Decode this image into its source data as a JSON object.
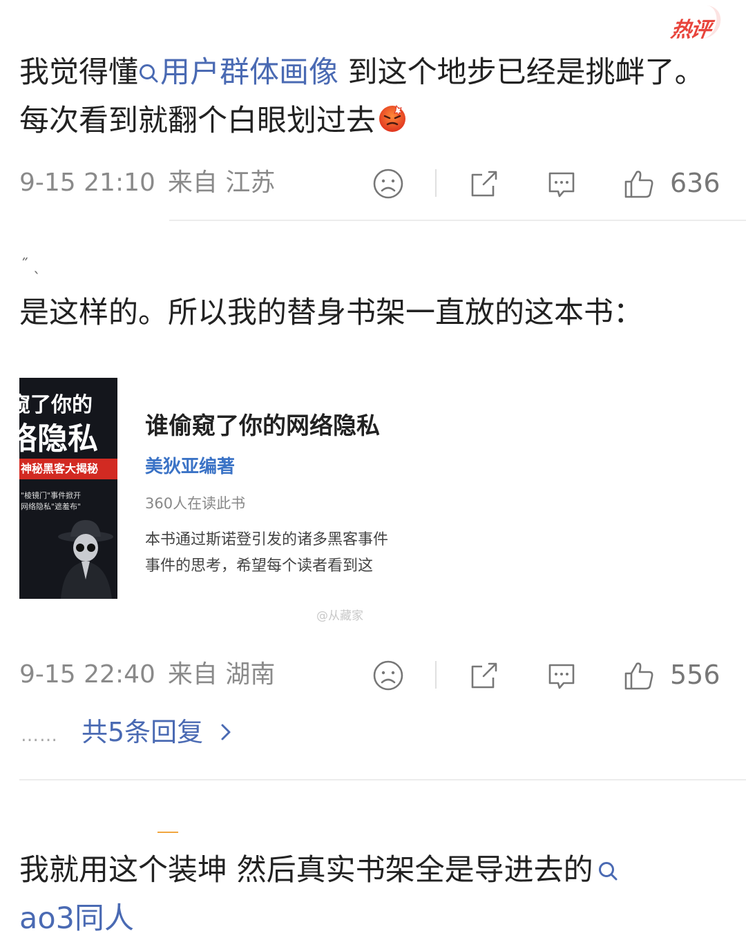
{
  "badge": {
    "label": "热评"
  },
  "comment1": {
    "text_before": "我觉得懂",
    "topic": "用户群体画像",
    "text_after": " 到这个地步已经是挑衅了。每次看到就翻个白眼划过去",
    "emoji": "angry-face-emoji",
    "time": "9-15 21:10",
    "location": "来自 江苏",
    "likes": "636"
  },
  "comment2": {
    "text": "是这样的。所以我的替身书架一直放的这本书：",
    "book": {
      "cover_line1": "窥了你的",
      "cover_line2": "络隐私",
      "cover_band": "神秘黑客大揭秘",
      "cover_text1": "\"棱镜门\"事件掀开",
      "cover_text2": "网络隐私\"遮羞布\"",
      "title": "谁偷窥了你的网络隐私",
      "author": "美狄亚编著",
      "readers": "360人在读此书",
      "desc_line1": "本书通过斯诺登引发的诸多黑客事件",
      "desc_line2": "事件的思考，希望每个读者看到这",
      "watermark": "@从藏家"
    },
    "time": "9-15 22:40",
    "location": "来自 湖南",
    "likes": "556",
    "replies_dots": "……",
    "replies_label": "共5条回复"
  },
  "comment3": {
    "text": "我就用这个装坤 然后真实书架全是导进去的",
    "topic": "ao3同人"
  },
  "icons": {
    "action1": "sad-face-icon",
    "action2": "share-icon",
    "action3": "comment-icon",
    "action4": "thumbs-up-icon"
  },
  "colors": {
    "topic": "#4a6ab3",
    "badge": "#e8453c",
    "meta": "#8a8a8a"
  }
}
